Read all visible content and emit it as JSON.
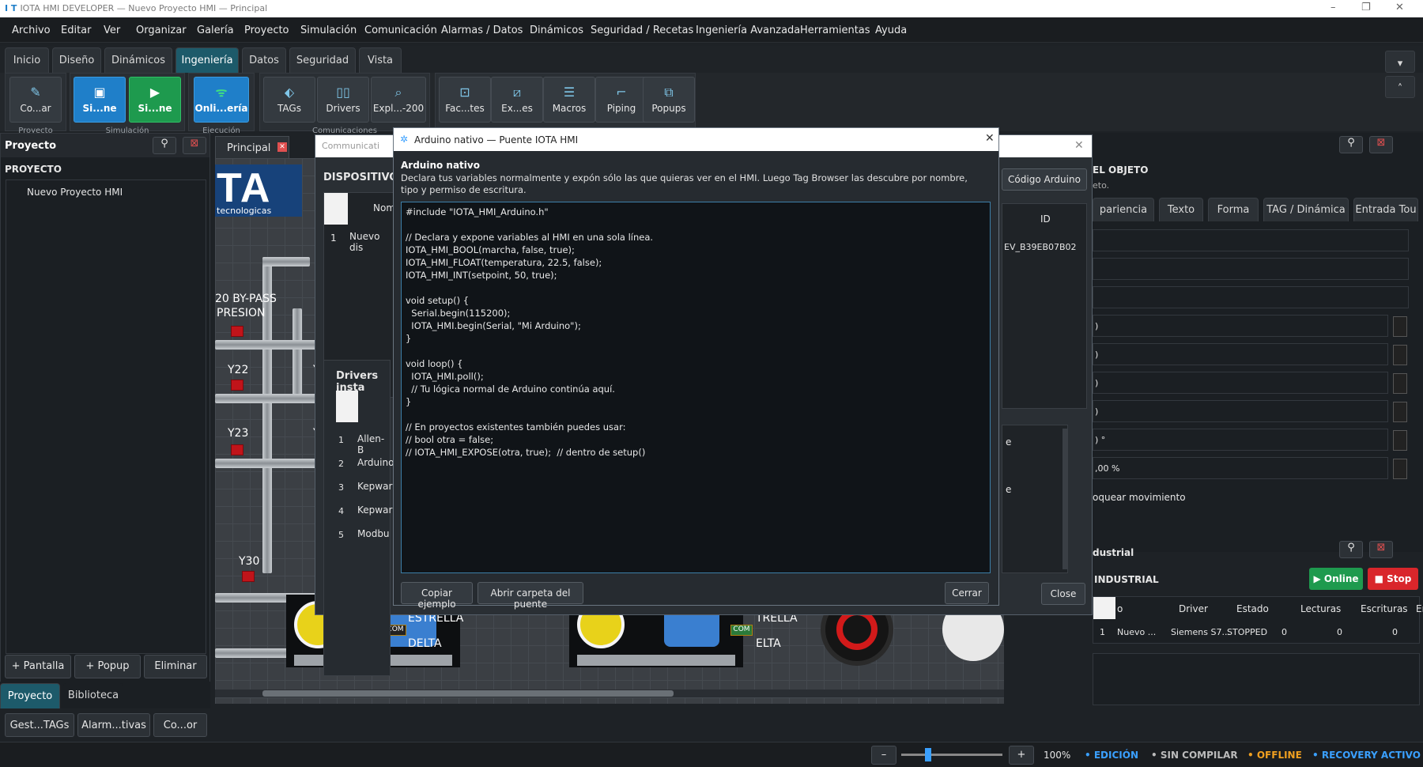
{
  "window": {
    "title": "IOTA HMI DEVELOPER — Nuevo Proyecto HMI — Principal",
    "app_icon": "I T",
    "min": "–",
    "max": "❐",
    "close": "✕"
  },
  "menu": [
    "Archivo",
    "Editar",
    "Ver",
    "Organizar",
    "Galería",
    "Proyecto",
    "Simulación",
    "Comunicación",
    "Alarmas / Datos",
    "Dinámicos",
    "Seguridad / Recetas",
    "Ingeniería Avanzada",
    "Herramientas",
    "Ayuda"
  ],
  "ribbon_tabs": [
    "Inicio",
    "Diseño",
    "Dinámicos",
    "Ingeniería",
    "Datos",
    "Seguridad",
    "Vista"
  ],
  "ribbon": {
    "buttons": [
      "Co...ar",
      "Si...ne",
      "Si...ne",
      "Onli...ería",
      "TAGs",
      "Drivers",
      "Expl...-200",
      "Fac...tes",
      "Ex...es",
      "Macros",
      "Piping",
      "Popups"
    ],
    "groups": [
      "Proyecto",
      "Simulación",
      "Ejecución",
      "Comunicaciones"
    ]
  },
  "left": {
    "panel_title": "Proyecto",
    "section": "PROYECTO",
    "tree_item": "Nuevo Proyecto HMI",
    "btn_pantalla": "+ Pantalla",
    "btn_popup": "+ Popup",
    "btn_eliminar": "Eliminar",
    "tab_proyecto": "Proyecto",
    "tab_biblioteca": "Biblioteca",
    "btn_tags": "Gest...TAGs",
    "btn_alarm": "Alarm...tivas",
    "btn_co": "Co...or"
  },
  "doc_tab": "Principal",
  "canvas": {
    "logo": "TA",
    "logo_sub": "tecnologicas",
    "bypass1": "20 BY-PASS",
    "bypass2": "PRESION",
    "y22": "Y22",
    "y23": "Y23",
    "y30": "Y30",
    "y_cut": "Y",
    "estrella": "ESTRELLA",
    "delta": "DELTA",
    "estrella2": "TRELLA",
    "delta2": "ELTA",
    "com": "COM"
  },
  "comm_dialog": {
    "title": "Communicati",
    "dispositivos": "DISPOSITIVOS",
    "codigo_btn": "Código Arduino",
    "col_nombre": "Nom",
    "col_id": "ID",
    "row1": {
      "num": "1",
      "nombre": "Nuevo dis",
      "id": "EV_B39EB07B02"
    },
    "drivers_title": "Drivers insta",
    "drivers": [
      {
        "num": "1",
        "name": "Allen-B"
      },
      {
        "num": "2",
        "name": "Arduino"
      },
      {
        "num": "3",
        "name": "Kepwar"
      },
      {
        "num": "4",
        "name": "Kepwar"
      },
      {
        "num": "5",
        "name": "Modbu"
      }
    ],
    "drv_right1": "e",
    "drv_right2": "e",
    "close_btn": "Close"
  },
  "arduino_dialog": {
    "title": "Arduino nativo — Puente IOTA HMI",
    "heading": "Arduino nativo",
    "desc": "Declara tus variables normalmente y expón sólo las que quieras ver en el HMI. Luego Tag Browser las descubre por nombre, tipo y permiso de escritura.",
    "code": "#include \"IOTA_HMI_Arduino.h\"\n\n// Declara y expone variables al HMI en una sola línea.\nIOTA_HMI_BOOL(marcha, false, true);\nIOTA_HMI_FLOAT(temperatura, 22.5, false);\nIOTA_HMI_INT(setpoint, 50, true);\n\nvoid setup() {\n  Serial.begin(115200);\n  IOTA_HMI.begin(Serial, \"Mi Arduino\");\n}\n\nvoid loop() {\n  IOTA_HMI.poll();\n  // Tu lógica normal de Arduino continúa aquí.\n}\n\n// En proyectos existentes también puedes usar:\n// bool otra = false;\n// IOTA_HMI_EXPOSE(otra, true);  // dentro de setup()",
    "copy_btn": "Copiar ejemplo",
    "open_btn": "Abrir carpeta del puente",
    "close_btn": "Cerrar",
    "close_x": "✕"
  },
  "props": {
    "title": "EL OBJETO",
    "sub": "eto.",
    "tabs": [
      "pariencia",
      "Texto",
      "Forma",
      "TAG / Dinámica",
      "Entrada Tou"
    ],
    "fields": [
      ")",
      ")",
      ")",
      ")",
      ") °",
      ",00 %"
    ],
    "lock": "oquear movimiento"
  },
  "industrial": {
    "title": "dustrial",
    "sub": "INDUSTRIAL",
    "online": "▶ Online",
    "stop": "■ Stop",
    "headers": [
      "o",
      "Driver",
      "Estado",
      "Lecturas",
      "Escrituras",
      "Errores"
    ],
    "row": {
      "num": "1",
      "name": "Nuevo ...",
      "driver": "Siemens S7...",
      "estado": "STOPPED",
      "lecturas": "0",
      "escrituras": "0",
      "errores": "0"
    }
  },
  "status": {
    "zoom": "100%",
    "minus": "–",
    "plus": "+",
    "zoom_level": 0.25,
    "edicion": "• EDICIÓN",
    "sin": "• SIN COMPILAR",
    "offline": "• OFFLINE",
    "recovery": "• RECOVERY ACTIVO"
  },
  "colors": {
    "accent": "#1f7fc9",
    "online": "#1e9a4e",
    "stop": "#d9262b",
    "offline": "#f0a020",
    "edicion": "#3aa0ff"
  }
}
